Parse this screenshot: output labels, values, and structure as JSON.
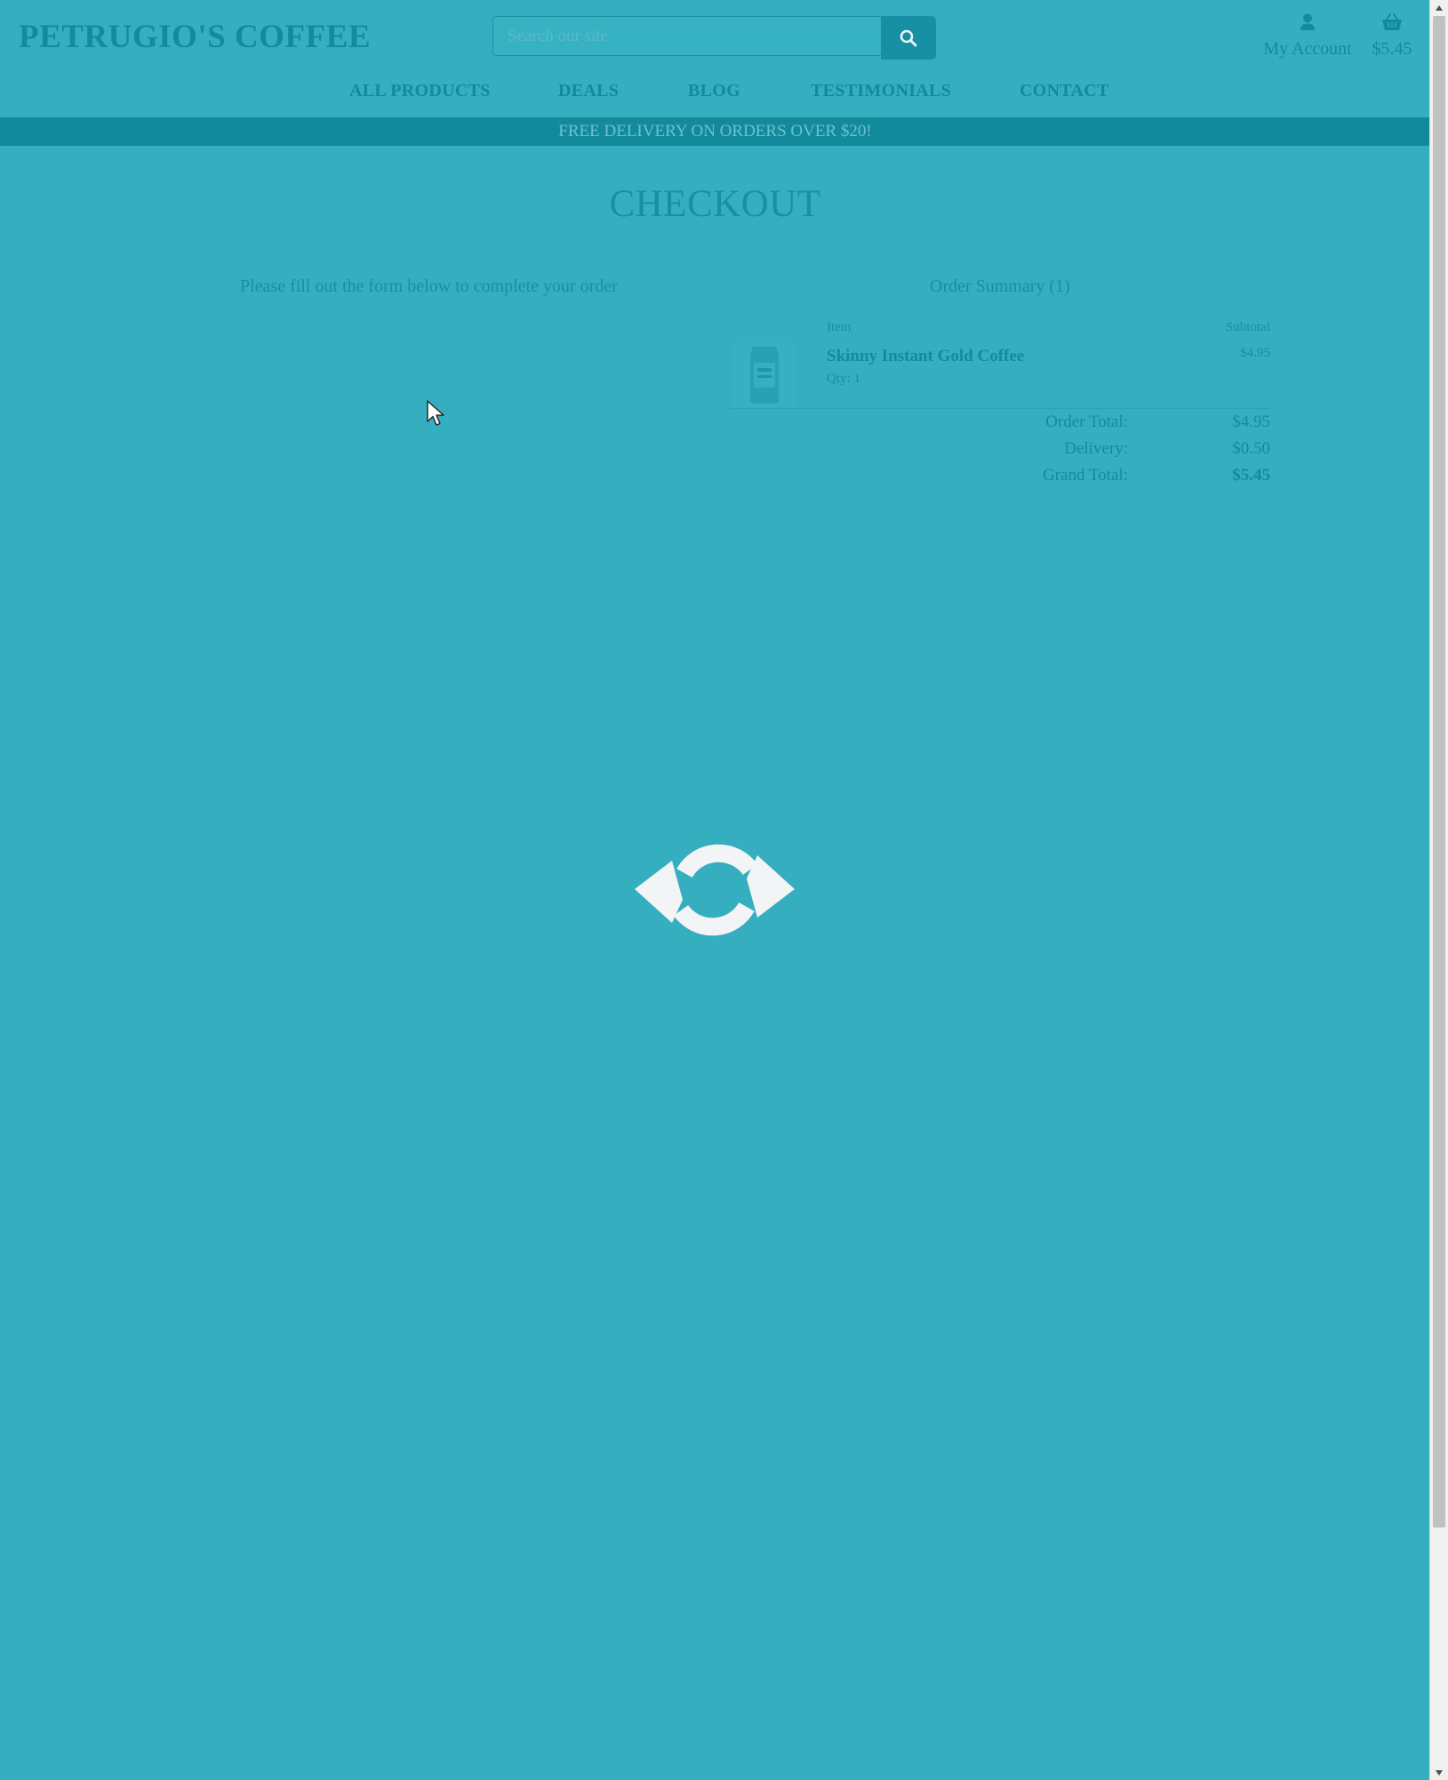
{
  "header": {
    "logo": "PETRUGIO'S COFFEE",
    "search_placeholder": "Search our site",
    "account_label": "My Account",
    "cart_total": "$5.45"
  },
  "nav": {
    "items": [
      "ALL PRODUCTS",
      "DEALS",
      "BLOG",
      "TESTIMONIALS",
      "CONTACT"
    ]
  },
  "banner": "FREE DELIVERY ON ORDERS OVER $20!",
  "checkout": {
    "title": "CHECKOUT",
    "intro": "Please fill out the form below to complete your order",
    "summary_title": "Order Summary (1)",
    "columns": {
      "item": "Item",
      "subtotal": "Subtotal"
    },
    "product": {
      "name": "Skinny Instant Gold Coffee",
      "qty": "Qty: 1",
      "price": "$4.95"
    },
    "totals": [
      {
        "label": "Order Total:",
        "value": "$4.95"
      },
      {
        "label": "Delivery:",
        "value": "$0.50"
      },
      {
        "label": "Grand Total:",
        "value": "$5.45"
      }
    ]
  },
  "colors": {
    "overlay": "#35aec0",
    "brand": "#138a9c",
    "spinner": "#f3f4f6"
  },
  "icons": [
    "search-icon",
    "user-icon",
    "basket-icon",
    "refresh-spinner-icon",
    "mouse-cursor-icon"
  ]
}
